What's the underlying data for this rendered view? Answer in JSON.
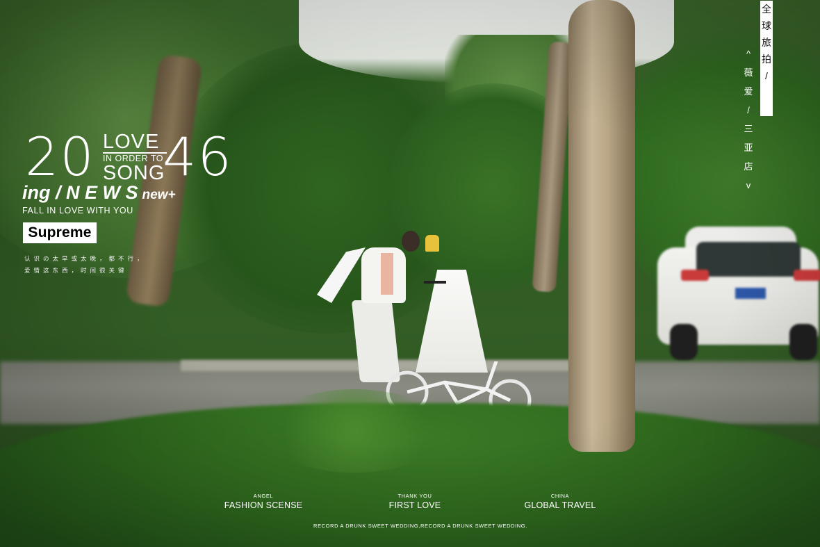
{
  "headline": {
    "year_left": "20",
    "year_right": "46",
    "love": "LOVE",
    "in_order_to": "IN ORDER TO",
    "song": "SONG"
  },
  "news": {
    "main": "ing / N E W S",
    "tail": "new+"
  },
  "tagline": "FALL IN LOVE WITH YOU",
  "badge": "Supreme",
  "chinese_lines": [
    "认识の太早或太晚，都不行，",
    "爱情这东西，时间很关键"
  ],
  "vertical": {
    "boxed": [
      "全",
      "球",
      "旅",
      "拍",
      "/"
    ],
    "plain": [
      "^",
      "薇",
      "爱",
      "/",
      "三",
      "亚",
      "店",
      "v"
    ]
  },
  "columns": [
    {
      "small": "ANGEL",
      "label": "FASHION SCENSE"
    },
    {
      "small": "THANK YOU",
      "label": "FIRST LOVE"
    },
    {
      "small": "CHINA",
      "label": "GLOBAL TRAVEL"
    }
  ],
  "footer": "RECORD A DRUNK SWEET WEDDING,RECORD A DRUNK SWEET WEDDING."
}
